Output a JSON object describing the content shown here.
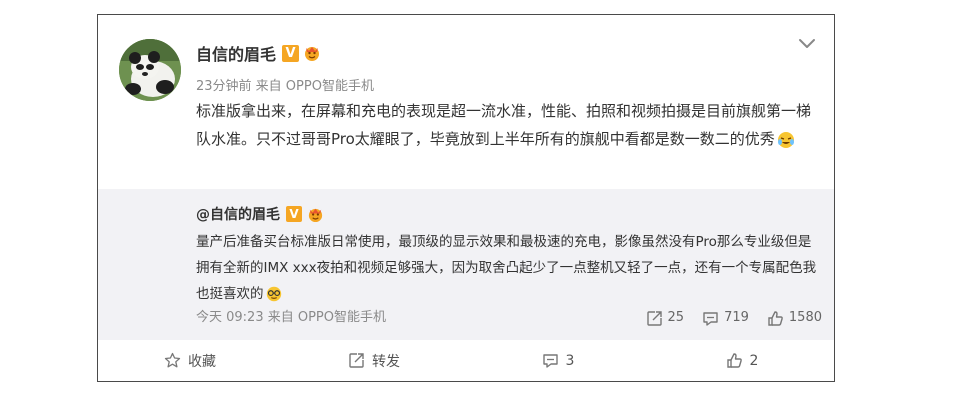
{
  "post": {
    "author": "自信的眉毛",
    "verified_badge": "V",
    "meta": "23分钟前 来自 OPPO智能手机",
    "text_main": "标准版拿出来，在屏幕和充电的表现是超一流水准，性能、拍照和视频拍摄是目前旗舰第一梯队水准。只不过哥哥Pro太耀眼了，毕竟放到上半年所有的旗舰中看都是数一数二的优秀",
    "icons": {
      "more": "chevron-down-icon",
      "emoji_end": "laugh-cry-emoji-icon"
    }
  },
  "retweet": {
    "author": "@自信的眉毛",
    "verified_badge": "V",
    "text_main": "量产后准备买台标准版日常使用，最顶级的显示效果和最极速的充电，影像虽然没有Pro那么专业级但是拥有全新的IMX xxx夜拍和视频足够强大，因为取舍凸起少了一点整机又轻了一点，还有一个专属配色我也挺喜欢的",
    "time": "今天 09:23 来自 OPPO智能手机",
    "repost_count": "25",
    "comment_count": "719",
    "like_count": "1580"
  },
  "actions": {
    "favorite": "收藏",
    "repost": "转发",
    "comment": "3",
    "like": "2"
  },
  "colors": {
    "badge": "#f5a623",
    "retweet_bg": "#f2f2f5",
    "meta_text": "#8a8a8a"
  }
}
